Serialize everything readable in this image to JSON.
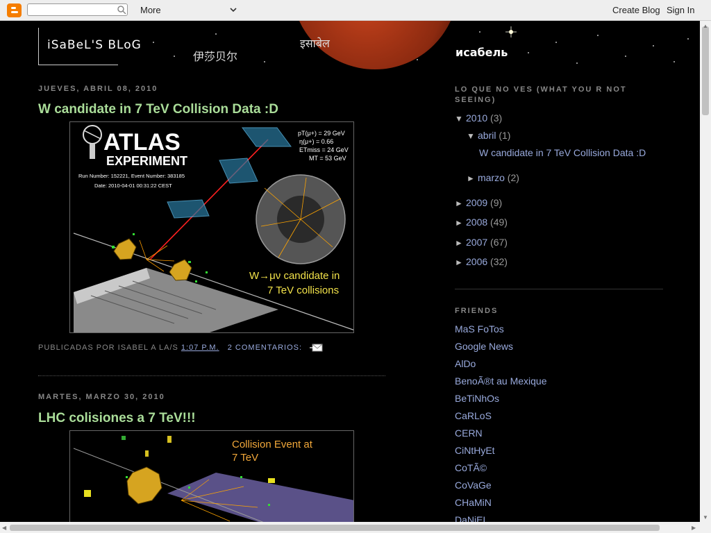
{
  "navbar": {
    "more_label": "More",
    "create_blog": "Create Blog",
    "sign_in": "Sign In",
    "search_placeholder": ""
  },
  "header": {
    "title": "iSaBeL'S BLoG",
    "chinese": "伊莎贝尔",
    "hindi": "इसाबेल",
    "russian": "исабель"
  },
  "posts": [
    {
      "date": "JUEVES, ABRIL 08, 2010",
      "title": "W candidate in 7 TeV Collision Data :D",
      "image": {
        "logo_top": "ATLAS",
        "logo_bottom": "EXPERIMENT",
        "run": "Run Number: 152221, Event Number: 383185",
        "date": "Date: 2010-04-01 00:31:22 CEST",
        "stats": [
          "pT(μ+) = 29 GeV",
          "η(μ+) =      0.66",
          "ETmiss = 24 GeV",
          "MT = 53 GeV"
        ],
        "caption1": "W→μν candidate in",
        "caption2": "7 TeV collisions"
      },
      "footer": {
        "by": "PUBLICADAS POR ISABEL A LA/S",
        "time": "1:07 P.M.",
        "comments": "2 COMENTARIOS:"
      }
    },
    {
      "date": "MARTES, MARZO 30, 2010",
      "title": "LHC colisiones a 7 TeV!!!",
      "image": {
        "caption1": "Collision Event at",
        "caption2": "7 TeV"
      }
    }
  ],
  "sidebar": {
    "archive_heading": "LO QUE NO VES (WHAT YOU R NOT SEEING)",
    "archive": [
      {
        "arrow": "▼",
        "label": "2010",
        "count": "(3)"
      },
      {
        "arrow": "▼",
        "label": "abril",
        "count": "(1)"
      },
      {
        "label": "W candidate in 7 TeV Collision Data :D"
      },
      {
        "arrow": "►",
        "label": "marzo",
        "count": "(2)"
      },
      {
        "arrow": "►",
        "label": "2009",
        "count": "(9)"
      },
      {
        "arrow": "►",
        "label": "2008",
        "count": "(49)"
      },
      {
        "arrow": "►",
        "label": "2007",
        "count": "(67)"
      },
      {
        "arrow": "►",
        "label": "2006",
        "count": "(32)"
      }
    ],
    "friends_heading": "FRIENDS",
    "friends": [
      "MaS FoTos",
      "Google News",
      "AlDo",
      "BenoÃ®t au Mexique",
      "BeTiNhOs",
      "CaRLoS",
      "CERN",
      "CiNtHyEt",
      "CoTÃ©",
      "CoVaGe",
      "CHaMiN",
      "DaNiEL"
    ]
  },
  "colors": {
    "post_title": "#aadd99",
    "link": "#99aadd",
    "muted": "#888888",
    "background": "#000000"
  }
}
